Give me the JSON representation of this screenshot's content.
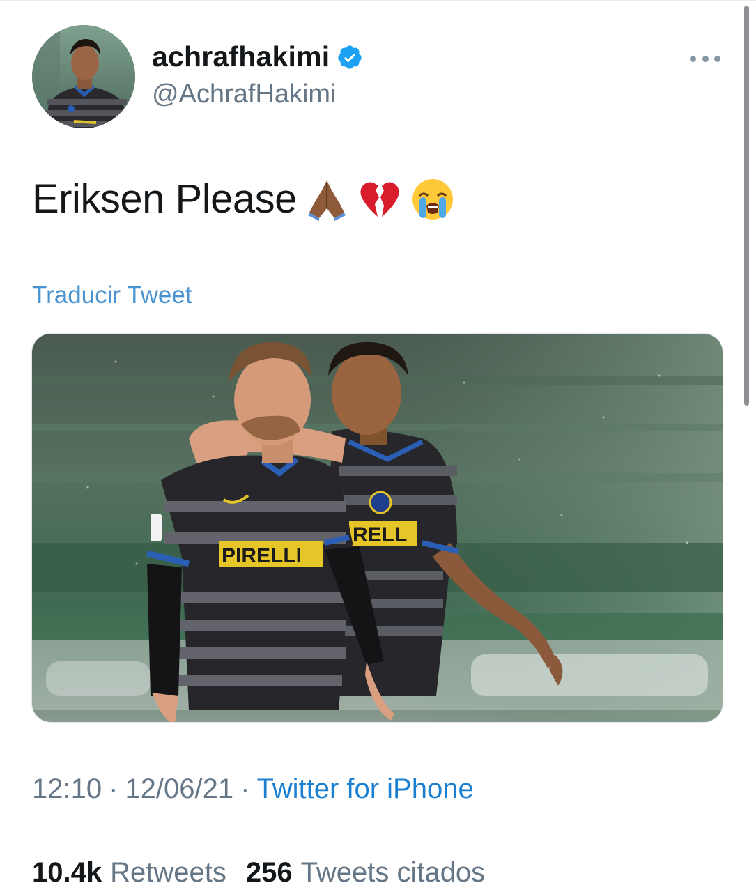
{
  "tweet": {
    "display_name": "achrafhakimi",
    "handle": "@AchrafHakimi",
    "text": "Eriksen Please",
    "emojis": [
      "folded-hands-emoji",
      "broken-heart-emoji",
      "loudly-crying-face-emoji"
    ],
    "translate_label": "Traducir Tweet",
    "time": "12:10",
    "date": "12/06/21",
    "separator": "·",
    "source": "Twitter for iPhone",
    "retweets_count": "10.4k",
    "retweets_label": "Retweets",
    "quotes_count": "256",
    "quotes_label": "Tweets citados"
  },
  "colors": {
    "accent": "#1DA1F2",
    "link": "#1b7fd1",
    "secondary_text": "#657786"
  },
  "icons": {
    "verified": "verified-badge-icon",
    "more": "more-options-icon"
  }
}
